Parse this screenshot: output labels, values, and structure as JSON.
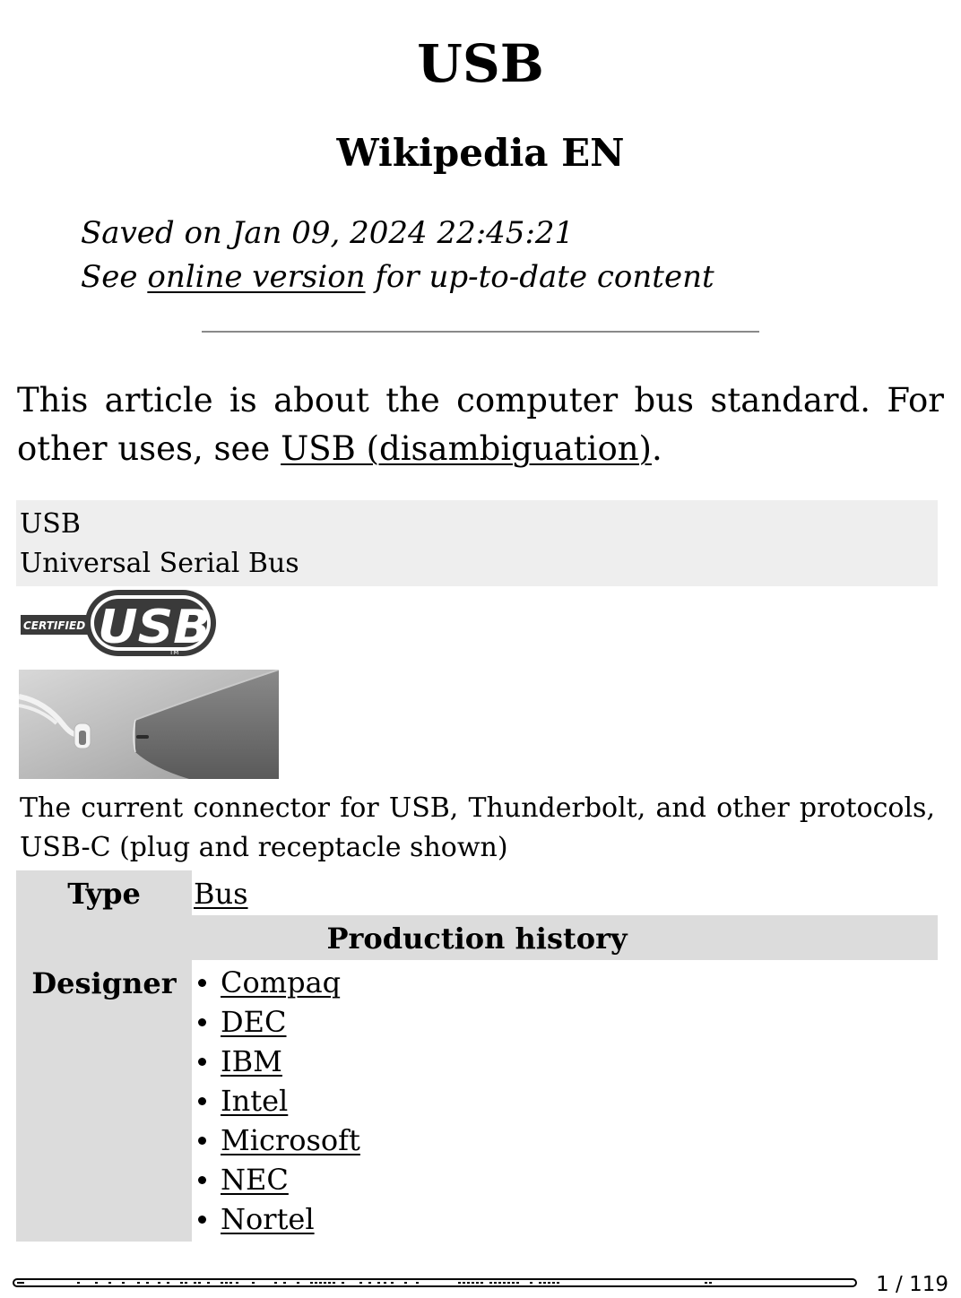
{
  "header": {
    "title": "USB",
    "subtitle": "Wikipedia EN",
    "saved_line": "Saved on Jan 09, 2024 22:45:21",
    "see_prefix": "See ",
    "online_link": "online version",
    "see_suffix": " for up-to-date content"
  },
  "hatnote": {
    "text_before": "This article is about the computer bus standard. For other uses, see ",
    "link": "USB (disambiguation)",
    "text_after": "."
  },
  "infobox": {
    "name": "USB",
    "full_name": "Universal Serial Bus",
    "logo": {
      "small_text": "CERTIFIED",
      "big_text": "USB",
      "tm": "TM"
    },
    "image_caption": "The current connector for USB, Thunderbolt, and other protocols, USB-C (plug and receptacle shown)",
    "type_label": "Type",
    "type_value": "Bus",
    "section_header": "Production history",
    "designer_label": "Designer",
    "designers": [
      "Compaq",
      "DEC",
      "IBM",
      "Intel",
      "Microsoft",
      "NEC",
      "Nortel"
    ]
  },
  "footer": {
    "page_indicator": "1 / 119",
    "progress_fraction": 0.0084
  }
}
